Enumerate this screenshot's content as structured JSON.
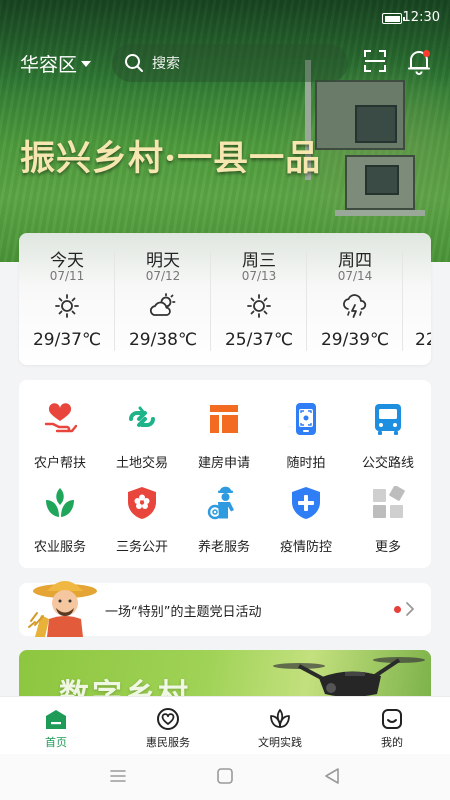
{
  "status_bar": {
    "time": "12:30"
  },
  "header": {
    "region": "华容区",
    "search_placeholder": "搜索",
    "slogan": "振兴乡村·一县一品"
  },
  "weather": [
    {
      "day": "今天",
      "date": "07/11",
      "condition": "sunny-icon",
      "temp": "29/37℃"
    },
    {
      "day": "明天",
      "date": "07/12",
      "condition": "partly-cloudy-icon",
      "temp": "29/38℃"
    },
    {
      "day": "周三",
      "date": "07/13",
      "condition": "sunny-icon",
      "temp": "25/37℃"
    },
    {
      "day": "周四",
      "date": "07/14",
      "condition": "thunderstorm-icon",
      "temp": "29/39℃"
    },
    {
      "day": "",
      "date": "",
      "condition": "",
      "temp": "22"
    }
  ],
  "services": [
    {
      "label": "农户帮扶",
      "icon": "heart-hand-icon",
      "color": "#e8453c"
    },
    {
      "label": "土地交易",
      "icon": "exchange-icon",
      "color": "#1fb38a"
    },
    {
      "label": "建房申请",
      "icon": "building-form-icon",
      "color": "#f26b21"
    },
    {
      "label": "随时拍",
      "icon": "phone-camera-icon",
      "color": "#2f7ef5"
    },
    {
      "label": "公交路线",
      "icon": "bus-icon",
      "color": "#1e8fe0"
    },
    {
      "label": "农业服务",
      "icon": "sprout-icon",
      "color": "#1fa65a"
    },
    {
      "label": "三务公开",
      "icon": "shield-flower-icon",
      "color": "#e8453c"
    },
    {
      "label": "养老服务",
      "icon": "elderly-icon",
      "color": "#2e9be0"
    },
    {
      "label": "疫情防控",
      "icon": "shield-plus-icon",
      "color": "#2f7ef5"
    },
    {
      "label": "更多",
      "icon": "more-grid-icon",
      "color": "#bfbfbf"
    }
  ],
  "news": {
    "text": "一场“特别”的主题党日活动"
  },
  "banner": {
    "title": "数字乡村"
  },
  "tabs": [
    {
      "label": "首页",
      "icon": "home-icon",
      "active": true
    },
    {
      "label": "惠民服务",
      "icon": "heart-icon",
      "active": false
    },
    {
      "label": "文明实践",
      "icon": "lotus-icon",
      "active": false
    },
    {
      "label": "我的",
      "icon": "profile-icon",
      "active": false
    }
  ],
  "colors": {
    "accent": "#1f9b58",
    "slogan": "#f6e7b0"
  }
}
